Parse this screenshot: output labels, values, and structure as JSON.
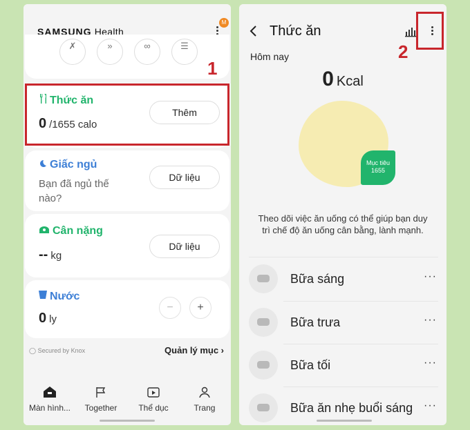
{
  "left": {
    "brand_name": "SAMSUNG",
    "brand_suffix": "Health",
    "badge": "M",
    "quick_icons": [
      "✗",
      "»",
      "∞",
      "☰"
    ],
    "food": {
      "icon": "fork-knife-icon",
      "title": "Thức ăn",
      "value": "0",
      "unit": "/1655 calo",
      "button": "Thêm"
    },
    "sleep": {
      "icon": "moon-icon",
      "title": "Giấc ngủ",
      "text": "Bạn đã ngủ thế nào?",
      "button": "Dữ liệu"
    },
    "weight": {
      "icon": "scale-icon",
      "title": "Cân nặng",
      "value": "--",
      "unit": "kg",
      "button": "Dữ liệu"
    },
    "water": {
      "icon": "cup-icon",
      "title": "Nước",
      "value": "0",
      "unit": "ly",
      "minus": "−",
      "plus": "+"
    },
    "secured": "Secured by Knox",
    "manage": "Quản lý mục ›",
    "nav": [
      {
        "icon": "home-icon",
        "label": "Màn hình..."
      },
      {
        "icon": "flag-icon",
        "label": "Together"
      },
      {
        "icon": "fitness-icon",
        "label": "Thể dục"
      },
      {
        "icon": "person-icon",
        "label": "Trang"
      }
    ],
    "callout_number": "1"
  },
  "right": {
    "title": "Thức ăn",
    "today": "Hôm nay",
    "kcal_value": "0",
    "kcal_unit": "Kcal",
    "goal_label": "Mục tiêu",
    "goal_value": "1655",
    "description": "Theo dõi việc ăn uống có thể giúp bạn duy trì chế độ ăn uống cân bằng, lành mạnh.",
    "meals": [
      {
        "label": "Bữa sáng"
      },
      {
        "label": "Bữa trưa"
      },
      {
        "label": "Bữa tối"
      },
      {
        "label": "Bữa ăn nhẹ buổi sáng"
      }
    ],
    "meal_more": "···",
    "callout_number": "2"
  },
  "colors": {
    "green": "#21b46c",
    "blue": "#3d7fd6",
    "callout_red": "#c8262c",
    "background": "#c9e4b3"
  }
}
